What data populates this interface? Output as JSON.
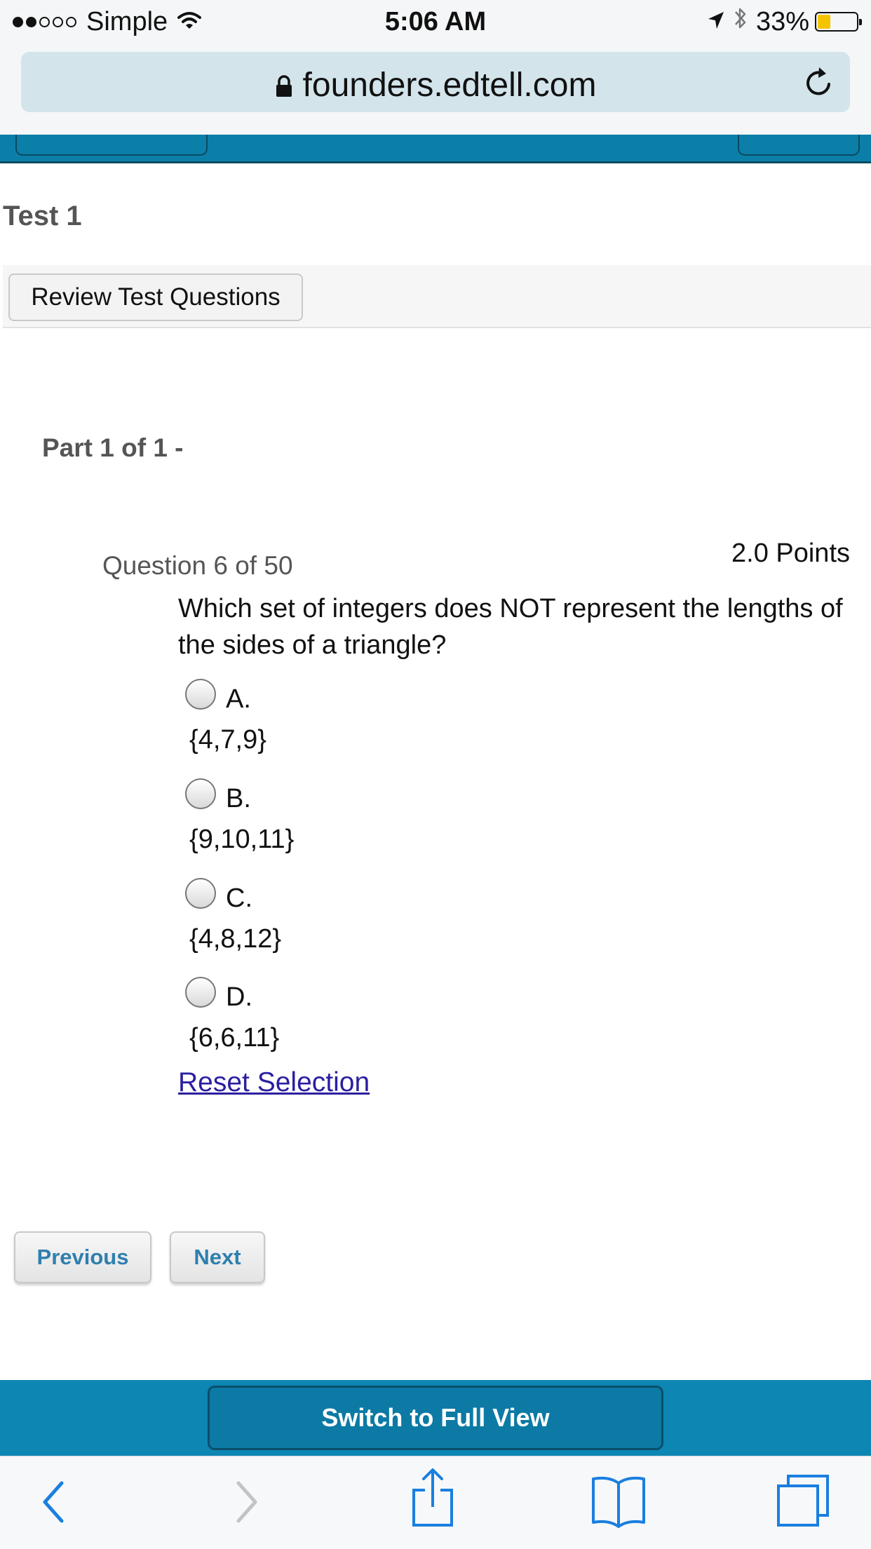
{
  "status_bar": {
    "carrier": "Simple",
    "time": "5:06 AM",
    "battery": "33%",
    "battery_level": 0.33,
    "signal_bars": 2,
    "signal_total": 5
  },
  "browser": {
    "url": "founders.edtell.com"
  },
  "page": {
    "title": "Test 1",
    "review_button": "Review Test Questions",
    "part_title": "Part 1 of 1 -",
    "question_number": "Question 6 of 50",
    "points": "2.0 Points",
    "question_text": "Which set of integers does NOT represent the lengths of the sides of a triangle?",
    "options": [
      {
        "letter": "A.",
        "value": "{4,7,9}"
      },
      {
        "letter": "B.",
        "value": "{9,10,11}"
      },
      {
        "letter": "C.",
        "value": "{4,8,12}"
      },
      {
        "letter": "D.",
        "value": "{6,6,11}"
      }
    ],
    "reset_link": "Reset Selection",
    "previous_button": "Previous",
    "next_button": "Next"
  },
  "footer": {
    "full_view_button": "Switch to Full View"
  },
  "colors": {
    "header_blue": "#0c7fa8",
    "footer_blue": "#0d86b4",
    "nav_button_text": "#2f7fae",
    "link": "#2a1fa0",
    "battery_fill": "#f5c400",
    "ios_blue": "#1a7fe0"
  },
  "icons": {
    "wifi": "wifi-icon",
    "location": "location-arrow-icon",
    "bluetooth": "bluetooth-icon",
    "lock": "lock-icon",
    "reload": "reload-icon",
    "back": "back-chevron-icon",
    "forward": "forward-chevron-icon",
    "share": "share-icon",
    "bookmarks": "bookmarks-icon",
    "tabs": "tabs-icon"
  }
}
